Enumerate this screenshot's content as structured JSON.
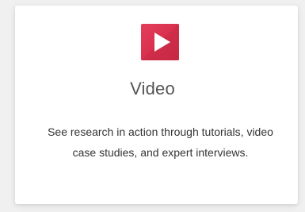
{
  "card": {
    "icon": "video-play-icon",
    "accent_color": "#e43d5b",
    "title": "Video",
    "description": "See research in action through tutorials, video case studies, and expert interviews."
  }
}
